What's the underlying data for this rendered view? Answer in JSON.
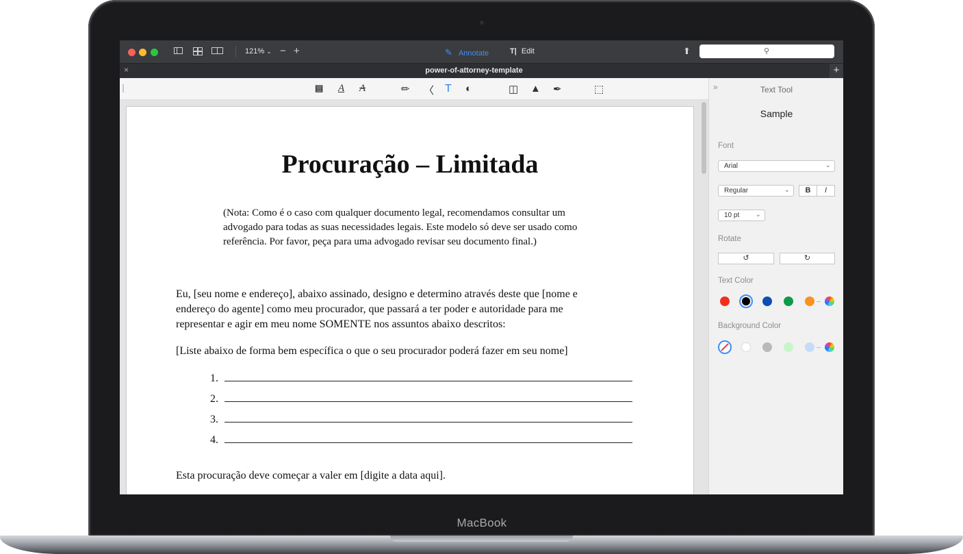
{
  "device": {
    "brand_label": "MacBook"
  },
  "toolbar": {
    "zoom": "121%",
    "modes": {
      "annotate": "Annotate",
      "edit": "Edit"
    },
    "search_placeholder": ""
  },
  "tab": {
    "title": "power-of-attorney-template"
  },
  "document": {
    "title": "Procuração – Limitada",
    "note": "(Nota: Como é o caso com qualquer documento legal, recomendamos consultar um advogado para todas as suas necessidades legais. Este modelo só deve ser usado como referência. Por favor, peça para uma advogado revisar seu documento final.)",
    "paragraph1": "Eu, [seu nome e endereço], abaixo assinado, designo e determino através deste que [nome e endereço do agente] como meu procurador, que passará a ter poder e autoridade para me representar e agir em meu nome SOMENTE nos assuntos abaixo descritos:",
    "paragraph2": "[Liste abaixo de forma bem específica o que o seu procurador poderá fazer em seu nome]",
    "list_items": [
      "1.",
      "2.",
      "3.",
      "4."
    ],
    "paragraph3": "Esta procuração deve começar a valer em [digite a data aqui]."
  },
  "panel": {
    "title": "Text Tool",
    "sample": "Sample",
    "font_label": "Font",
    "font_value": "Arial",
    "style_value": "Regular",
    "bold_label": "B",
    "italic_label": "I",
    "size_value": "10 pt",
    "rotate_label": "Rotate",
    "text_color_label": "Text Color",
    "text_colors": [
      "#f0301e",
      "#000000",
      "#0b4fb4",
      "#0e9a48",
      "#f7931e"
    ],
    "background_color_label": "Background Color",
    "background_colors": [
      "#ffffff",
      "#b9b9b9",
      "#c7f5c8",
      "#c5dcf7"
    ]
  },
  "colors": {
    "accent": "#2f80ed",
    "traffic_close": "#fe5f57",
    "traffic_minimize": "#febc2e",
    "traffic_zoom": "#28c840"
  }
}
